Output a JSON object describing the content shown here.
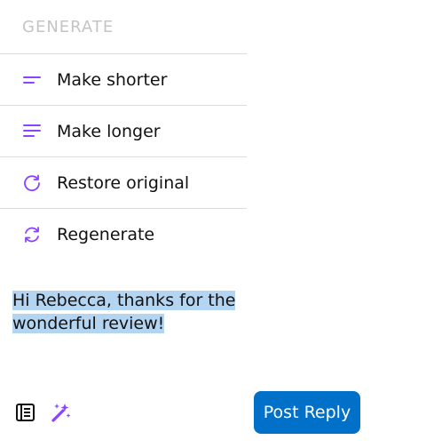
{
  "menu": {
    "header": "GENERATE",
    "items": [
      {
        "label": "Make shorter",
        "icon": "short-text-icon"
      },
      {
        "label": "Make longer",
        "icon": "long-text-icon"
      },
      {
        "label": "Restore original",
        "icon": "restore-icon"
      },
      {
        "label": "Regenerate",
        "icon": "regenerate-icon"
      }
    ]
  },
  "editor": {
    "text_line1": "Hi Rebecca, thanks for the",
    "text_line2": "wonderful review!"
  },
  "toolbar": {
    "template_icon": "template-icon",
    "ai_icon": "ai-sparkle-icon",
    "post_label": "Post Reply"
  },
  "colors": {
    "accent_purple": "#8a44ff",
    "button_blue": "#0070c9",
    "selection": "#b4d5f2"
  }
}
